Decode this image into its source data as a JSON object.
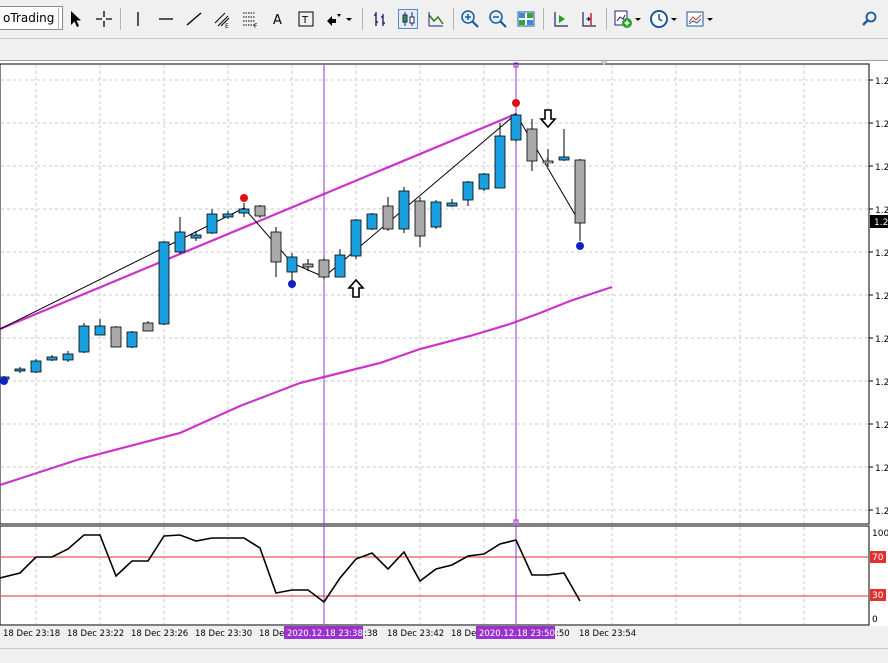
{
  "toolbar": {
    "algo_label": "oTrading"
  },
  "chart": {
    "price_label_prefix": "1.2",
    "current_price_label": "1.2",
    "rsi_levels": [
      "100",
      "70",
      "30",
      "0"
    ],
    "time_labels": [
      "18 Dec 23:18",
      "18 Dec 23:22",
      "18 Dec 23:26",
      "18 Dec 23:30",
      "18 De",
      ":38",
      "18 Dec 23:42",
      "18 De",
      ":50",
      "18 Dec 23:54"
    ],
    "crosshair_labels": [
      "2020.12.18 23:38",
      "2020.12.18 23:50"
    ]
  },
  "colors": {
    "bull": "#1aa0e0",
    "bear": "#a9a9a9",
    "envelope": "#cc33cc",
    "vline": "#9933cc",
    "rsi_level": "#e03030",
    "dot_high": "#dd1111",
    "dot_low": "#1122cc"
  }
}
